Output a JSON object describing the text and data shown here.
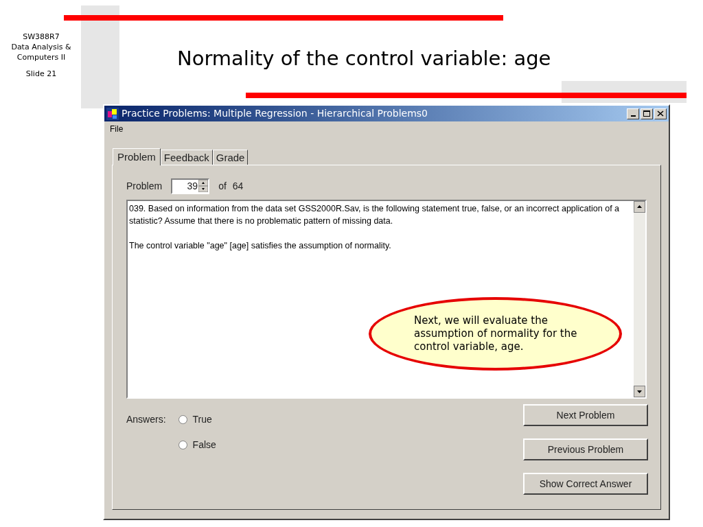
{
  "slide_info": {
    "course_code": "SW388R7",
    "course_name": [
      "Data Analysis &",
      "Computers II"
    ],
    "slide_number": "Slide 21"
  },
  "title": "Normality of the control variable: age",
  "window": {
    "title": "Practice Problems:  Multiple Regression - Hierarchical Problems0",
    "menu": [
      "File"
    ],
    "tabs": [
      {
        "label": "Problem",
        "selected": true
      },
      {
        "label": "Feedback",
        "selected": false
      },
      {
        "label": "Grade",
        "selected": false
      }
    ],
    "problem_label": "Problem",
    "problem_number": "39",
    "of_label": "of",
    "problem_count": "64",
    "problem_text": [
      "039. Based on information from the data set GSS2000R.Sav, is the following statement true, false, or an incorrect application of a statistic? Assume that there is no problematic pattern of missing data.",
      "The control variable \"age\" [age] satisfies the assumption of normality."
    ],
    "answers_label": "Answers:",
    "answers": [
      {
        "label": "True",
        "selected": false
      },
      {
        "label": "False",
        "selected": false
      }
    ],
    "buttons": [
      "Next Problem",
      "Previous Problem",
      "Show Correct Answer"
    ]
  },
  "callout": "Next, we will evaluate the assumption of normality for the control variable, age."
}
